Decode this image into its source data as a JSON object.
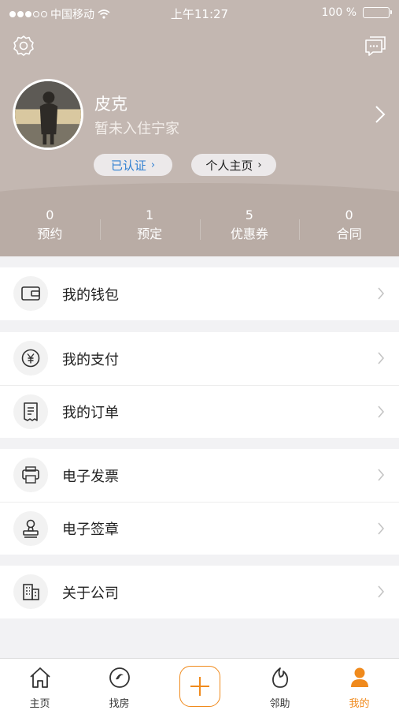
{
  "status_bar": {
    "carrier": "中国移动",
    "time": "上午11:27",
    "battery": "100 %"
  },
  "profile": {
    "name": "皮克",
    "subtitle": "暂未入住宁家",
    "verified_label": "已认证",
    "homepage_label": "个人主页"
  },
  "stats": [
    {
      "value": "0",
      "label": "预约"
    },
    {
      "value": "1",
      "label": "预定"
    },
    {
      "value": "5",
      "label": "优惠券"
    },
    {
      "value": "0",
      "label": "合同"
    }
  ],
  "menu": {
    "wallet": "我的钱包",
    "payment": "我的支付",
    "orders": "我的订单",
    "invoice": "电子发票",
    "seal": "电子签章",
    "about": "关于公司"
  },
  "tabs": [
    {
      "label": "主页",
      "icon": "home-icon"
    },
    {
      "label": "找房",
      "icon": "find-house-icon"
    },
    {
      "label": "",
      "icon": "plus-icon"
    },
    {
      "label": "邻助",
      "icon": "neighbor-help-icon"
    },
    {
      "label": "我的",
      "icon": "user-icon"
    }
  ],
  "colors": {
    "header_bg": "#c3b7b1",
    "accent_orange": "#f08a1c",
    "verified_blue": "#2f7fd1"
  }
}
